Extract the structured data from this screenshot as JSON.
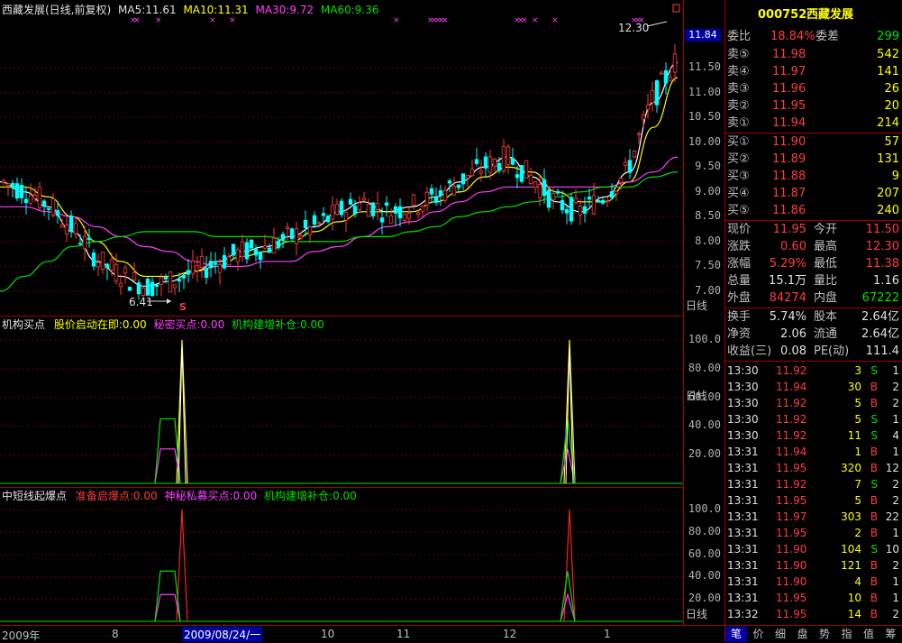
{
  "header": {
    "title": "西藏发展(日线,前复权)",
    "ma5": "MA5:11.61",
    "ma10": "MA10:11.31",
    "ma30": "MA30:9.72",
    "ma60": "MA60:9.36"
  },
  "price_panel": {
    "y_ticks": [
      "11.50",
      "11.00",
      "10.50",
      "10.00",
      "9.50",
      "9.00",
      "8.50",
      "8.00",
      "7.50",
      "7.00"
    ],
    "current_tag": "11.84",
    "high_label": "12.30",
    "low_label": "6.41",
    "s_marker": "S"
  },
  "panel2": {
    "title": "机构买点",
    "item1": "股价启动在即:0.00",
    "item2": "秘密买点:0.00",
    "item3": "机构建增补仓:0.00",
    "y_ticks": [
      "100.0",
      "80.00",
      "60.00",
      "40.00",
      "20.00"
    ]
  },
  "panel3": {
    "title": "中短线起爆点",
    "item1": "准备启爆点:0.00",
    "item2": "神秘私募买点:0.00",
    "item3": "机构建增补仓:0.00",
    "y_ticks": [
      "100.0",
      "80.00",
      "60.00",
      "40.00",
      "20.00"
    ]
  },
  "x_axis": {
    "labels": [
      "2009年",
      "8",
      "2009/08/24/一",
      "10",
      "11",
      "12",
      "1"
    ]
  },
  "side_tabs": [
    "日线",
    "日线",
    "日线"
  ],
  "quote": {
    "code": "000752",
    "name": "西藏发展",
    "webi_label": "委比",
    "webi_value": "18.84%",
    "weicha_label": "委差",
    "weicha_value": "299",
    "sells": [
      {
        "label": "卖⑤",
        "price": "11.98",
        "vol": "542"
      },
      {
        "label": "卖④",
        "price": "11.97",
        "vol": "141"
      },
      {
        "label": "卖③",
        "price": "11.96",
        "vol": "26"
      },
      {
        "label": "卖②",
        "price": "11.95",
        "vol": "20"
      },
      {
        "label": "卖①",
        "price": "11.94",
        "vol": "214"
      }
    ],
    "buys": [
      {
        "label": "买①",
        "price": "11.90",
        "vol": "57"
      },
      {
        "label": "买②",
        "price": "11.89",
        "vol": "131"
      },
      {
        "label": "买③",
        "price": "11.88",
        "vol": "9"
      },
      {
        "label": "买④",
        "price": "11.87",
        "vol": "207"
      },
      {
        "label": "买⑤",
        "price": "11.86",
        "vol": "240"
      }
    ],
    "stats": [
      {
        "l1": "现价",
        "v1": "11.95",
        "c1": "red",
        "l2": "今开",
        "v2": "11.50",
        "c2": "red"
      },
      {
        "l1": "涨跌",
        "v1": "0.60",
        "c1": "red",
        "l2": "最高",
        "v2": "12.30",
        "c2": "red"
      },
      {
        "l1": "涨幅",
        "v1": "5.29%",
        "c1": "red",
        "l2": "最低",
        "v2": "11.38",
        "c2": "red"
      },
      {
        "l1": "总量",
        "v1": "15.1万",
        "c1": "white",
        "l2": "量比",
        "v2": "1.16",
        "c2": "white"
      },
      {
        "l1": "外盘",
        "v1": "84274",
        "c1": "red",
        "l2": "内盘",
        "v2": "67222",
        "c2": "green"
      }
    ],
    "stats2": [
      {
        "l1": "换手",
        "v1": "5.74%",
        "l2": "股本",
        "v2": "2.64亿"
      },
      {
        "l1": "净资",
        "v1": "2.06",
        "l2": "流通",
        "v2": "2.64亿"
      },
      {
        "l1": "收益(三)",
        "v1": "0.08",
        "l2": "PE(动)",
        "v2": "111.4"
      }
    ],
    "ticks": [
      {
        "t": "13:30",
        "p": "11.92",
        "v": "3",
        "bs": "S",
        "n": "1"
      },
      {
        "t": "13:30",
        "p": "11.94",
        "v": "30",
        "bs": "B",
        "n": "2"
      },
      {
        "t": "13:30",
        "p": "11.92",
        "v": "5",
        "bs": "B",
        "n": "2"
      },
      {
        "t": "13:30",
        "p": "11.92",
        "v": "5",
        "bs": "S",
        "n": "1"
      },
      {
        "t": "13:30",
        "p": "11.92",
        "v": "11",
        "bs": "S",
        "n": "4"
      },
      {
        "t": "13:31",
        "p": "11.94",
        "v": "1",
        "bs": "B",
        "n": "1"
      },
      {
        "t": "13:31",
        "p": "11.95",
        "v": "320",
        "bs": "B",
        "n": "12"
      },
      {
        "t": "13:31",
        "p": "11.92",
        "v": "7",
        "bs": "S",
        "n": "2"
      },
      {
        "t": "13:31",
        "p": "11.95",
        "v": "5",
        "bs": "B",
        "n": "2"
      },
      {
        "t": "13:31",
        "p": "11.97",
        "v": "303",
        "bs": "B",
        "n": "22"
      },
      {
        "t": "13:31",
        "p": "11.95",
        "v": "2",
        "bs": "B",
        "n": "1"
      },
      {
        "t": "13:31",
        "p": "11.90",
        "v": "104",
        "bs": "S",
        "n": "10"
      },
      {
        "t": "13:31",
        "p": "11.90",
        "v": "121",
        "bs": "B",
        "n": "2"
      },
      {
        "t": "13:31",
        "p": "11.90",
        "v": "4",
        "bs": "B",
        "n": "1"
      },
      {
        "t": "13:31",
        "p": "11.95",
        "v": "10",
        "bs": "B",
        "n": "1"
      },
      {
        "t": "13:32",
        "p": "11.95",
        "v": "14",
        "bs": "B",
        "n": "2"
      }
    ],
    "bottom_tabs": [
      "笔",
      "价",
      "细",
      "盘",
      "势",
      "指",
      "值",
      "筹"
    ]
  },
  "colors": {
    "up": "#ff3c3c",
    "down": "#00ffff",
    "ma5": "#ffffff",
    "ma10": "#ffff00",
    "ma30": "#ff40ff",
    "ma60": "#00e000"
  },
  "chart_data": [
    {
      "type": "line",
      "title": "西藏发展(日线,前复权)",
      "series": [
        {
          "name": "MA5",
          "values": [
            9.2,
            9.0,
            8.7,
            8.2,
            7.6,
            7.3,
            7.1,
            7.2,
            7.4,
            7.6,
            7.8,
            7.9,
            8.1,
            8.3,
            8.6,
            8.8,
            8.6,
            8.7,
            8.9,
            9.2,
            9.5,
            9.7,
            9.3,
            8.8,
            8.6,
            8.9,
            9.4,
            10.8,
            11.6
          ]
        },
        {
          "name": "MA10",
          "values": [
            9.1,
            9.1,
            8.9,
            8.5,
            8.0,
            7.6,
            7.3,
            7.3,
            7.4,
            7.5,
            7.7,
            7.8,
            8.0,
            8.2,
            8.4,
            8.6,
            8.6,
            8.6,
            8.8,
            9.0,
            9.3,
            9.5,
            9.4,
            9.0,
            8.8,
            8.8,
            9.2,
            10.3,
            11.3
          ]
        },
        {
          "name": "MA30",
          "values": [
            8.7,
            8.7,
            8.6,
            8.5,
            8.3,
            8.1,
            7.9,
            7.8,
            7.6,
            7.5,
            7.5,
            7.6,
            7.6,
            7.8,
            7.9,
            8.1,
            8.3,
            8.4,
            8.6,
            8.8,
            9.0,
            9.1,
            9.1,
            9.1,
            9.1,
            9.1,
            9.2,
            9.4,
            9.7
          ]
        },
        {
          "name": "MA60",
          "values": [
            7.0,
            7.3,
            7.6,
            7.9,
            8.0,
            8.1,
            8.2,
            8.2,
            8.2,
            8.1,
            8.1,
            8.1,
            8.0,
            8.0,
            8.0,
            8.1,
            8.1,
            8.2,
            8.3,
            8.5,
            8.6,
            8.7,
            8.8,
            8.9,
            9.0,
            9.1,
            9.1,
            9.3,
            9.4
          ]
        }
      ],
      "ylim": [
        6.6,
        12.5
      ],
      "annotations": [
        "12.30",
        "6.41"
      ]
    },
    {
      "type": "line",
      "title": "机构买点",
      "x": [
        0,
        1,
        2,
        3,
        4,
        5,
        6,
        7,
        8,
        9,
        10,
        11,
        12,
        13,
        14,
        15,
        16,
        17,
        18,
        19,
        20
      ],
      "series": [
        {
          "name": "股价启动在即",
          "values": [
            0,
            0,
            0,
            0,
            0,
            0,
            100,
            0,
            0,
            0,
            0,
            0,
            0,
            0,
            0,
            0,
            0,
            0,
            0,
            100,
            0
          ]
        },
        {
          "name": "秘密买点",
          "values": [
            0,
            0,
            0,
            0,
            24,
            24,
            0,
            0,
            0,
            0,
            0,
            0,
            0,
            0,
            0,
            0,
            0,
            0,
            0,
            25,
            0
          ]
        },
        {
          "name": "机构建增补仓",
          "values": [
            0,
            0,
            0,
            0,
            45,
            45,
            0,
            0,
            0,
            0,
            0,
            0,
            0,
            0,
            0,
            0,
            0,
            0,
            0,
            45,
            0
          ]
        }
      ],
      "ylim": [
        0,
        105
      ]
    },
    {
      "type": "line",
      "title": "中短线起爆点",
      "x": [
        0,
        1,
        2,
        3,
        4,
        5,
        6,
        7,
        8,
        9,
        10,
        11,
        12,
        13,
        14,
        15,
        16,
        17,
        18,
        19,
        20
      ],
      "series": [
        {
          "name": "准备启爆点",
          "values": [
            0,
            0,
            0,
            0,
            0,
            0,
            100,
            0,
            0,
            0,
            0,
            0,
            0,
            0,
            0,
            0,
            0,
            0,
            0,
            100,
            0
          ]
        },
        {
          "name": "神秘私募买点",
          "values": [
            0,
            0,
            0,
            0,
            24,
            24,
            0,
            0,
            0,
            0,
            0,
            0,
            0,
            0,
            0,
            0,
            0,
            0,
            0,
            25,
            0
          ]
        },
        {
          "name": "机构建增补仓",
          "values": [
            0,
            0,
            0,
            0,
            45,
            45,
            0,
            0,
            0,
            0,
            0,
            0,
            0,
            0,
            0,
            0,
            0,
            0,
            0,
            45,
            0
          ]
        }
      ],
      "ylim": [
        0,
        105
      ]
    }
  ]
}
